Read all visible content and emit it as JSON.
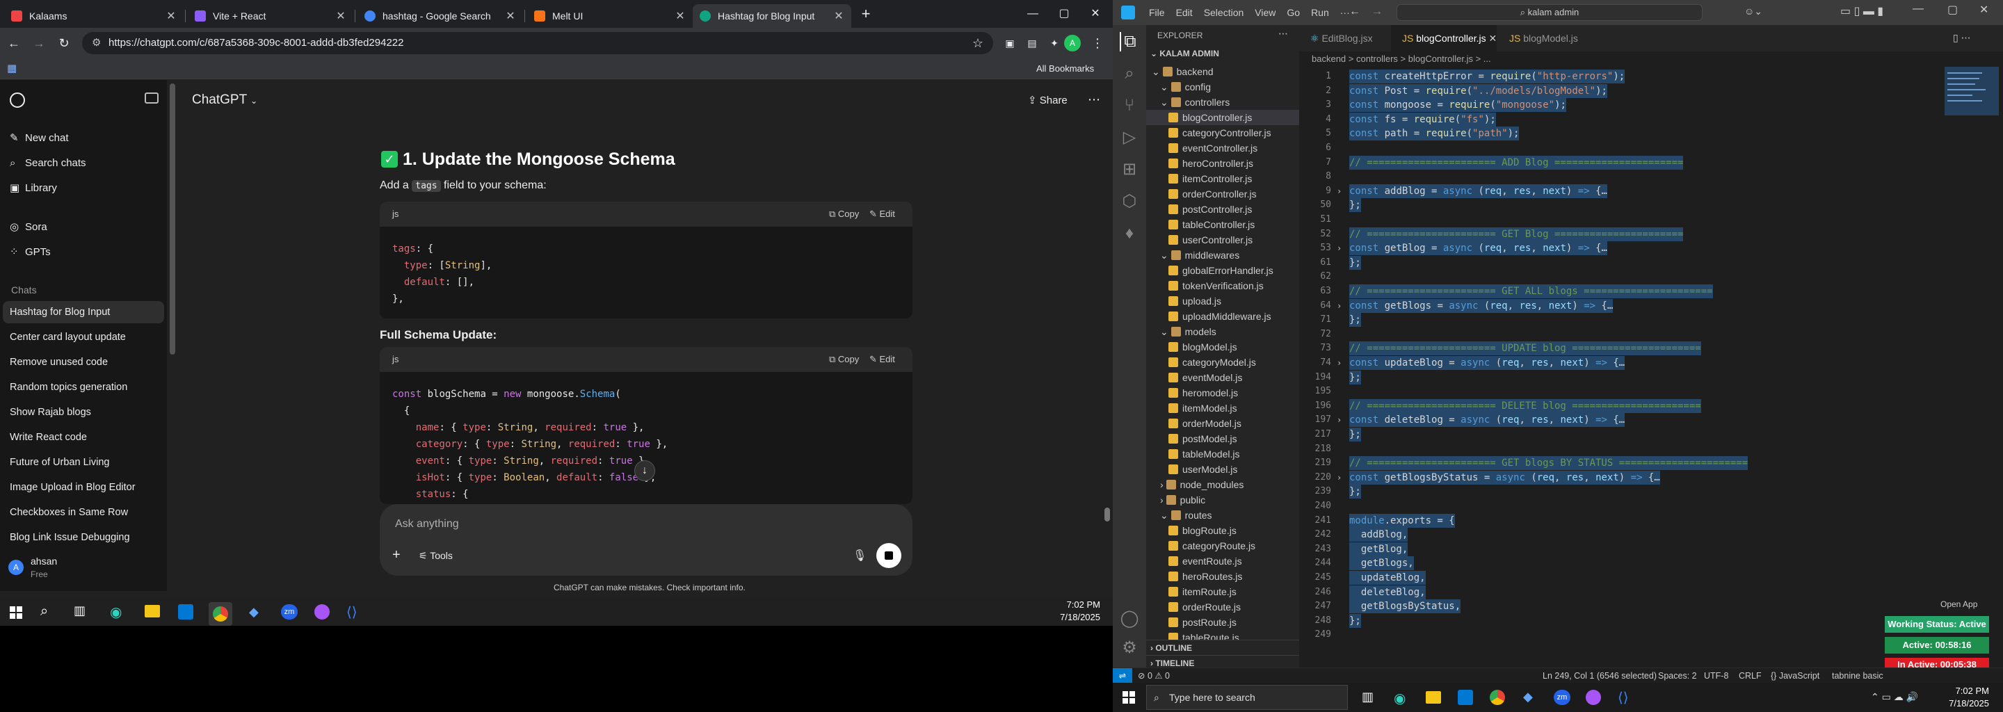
{
  "browser": {
    "tabs": [
      {
        "title": "Kalaams",
        "color": "#ef4444"
      },
      {
        "title": "Vite + React",
        "color": "#8b5cf6"
      },
      {
        "title": "hashtag - Google Search",
        "color": "#4285f4"
      },
      {
        "title": "Melt UI",
        "color": "#f97316"
      },
      {
        "title": "Hashtag for Blog Input",
        "color": "#10a37f"
      }
    ],
    "new_tab": "+",
    "url": "https://chatgpt.com/c/687a5368-309c-8001-addd-db3fed294222",
    "all_bookmarks": "All Bookmarks",
    "win_min": "—",
    "win_max": "▢",
    "win_close": "✕"
  },
  "sidebar": {
    "new_chat": "New chat",
    "search_chats": "Search chats",
    "library": "Library",
    "sora": "Sora",
    "gpts": "GPTs",
    "chats_heading": "Chats",
    "chats": [
      "Hashtag for Blog Input",
      "Center card layout update",
      "Remove unused code",
      "Random topics generation",
      "Show Rajab blogs",
      "Write React code",
      "Future of Urban Living",
      "Image Upload in Blog Editor",
      "Checkboxes in Same Row",
      "Blog Link Issue Debugging"
    ],
    "user_initial": "A",
    "user_name": "ahsan",
    "user_plan": "Free"
  },
  "chat": {
    "model": "ChatGPT",
    "share": "Share",
    "heading": "1. Update the Mongoose Schema",
    "intro_pre": "Add a",
    "intro_code": "tags",
    "intro_post": "field to your schema:",
    "code1_lang": "js",
    "copy": "Copy",
    "edit": "Edit",
    "full_heading": "Full Schema Update:",
    "code2_lang": "js",
    "composer_placeholder": "Ask anything",
    "tools": "Tools",
    "disclaimer": "ChatGPT can make mistakes. Check important info."
  },
  "taskbar_left": {
    "time": "7:02 PM",
    "date": "7/18/2025"
  },
  "vscode": {
    "menu": [
      "File",
      "Edit",
      "Selection",
      "View",
      "Go",
      "Run",
      "···"
    ],
    "search": "kalam admin",
    "explorer_title": "EXPLORER",
    "root": "KALAM ADMIN",
    "tree": [
      {
        "label": "backend",
        "indent": 0,
        "type": "folder"
      },
      {
        "label": "config",
        "indent": 1,
        "type": "folder"
      },
      {
        "label": "controllers",
        "indent": 1,
        "type": "folder"
      },
      {
        "label": "blogController.js",
        "indent": 2,
        "type": "js",
        "selected": true
      },
      {
        "label": "categoryController.js",
        "indent": 2,
        "type": "js"
      },
      {
        "label": "eventController.js",
        "indent": 2,
        "type": "js"
      },
      {
        "label": "heroController.js",
        "indent": 2,
        "type": "js"
      },
      {
        "label": "itemController.js",
        "indent": 2,
        "type": "js"
      },
      {
        "label": "orderController.js",
        "indent": 2,
        "type": "js"
      },
      {
        "label": "postController.js",
        "indent": 2,
        "type": "js"
      },
      {
        "label": "tableController.js",
        "indent": 2,
        "type": "js"
      },
      {
        "label": "userController.js",
        "indent": 2,
        "type": "js"
      },
      {
        "label": "middlewares",
        "indent": 1,
        "type": "folder"
      },
      {
        "label": "globalErrorHandler.js",
        "indent": 2,
        "type": "js"
      },
      {
        "label": "tokenVerification.js",
        "indent": 2,
        "type": "js"
      },
      {
        "label": "upload.js",
        "indent": 2,
        "type": "js"
      },
      {
        "label": "uploadMiddleware.js",
        "indent": 2,
        "type": "js"
      },
      {
        "label": "models",
        "indent": 1,
        "type": "folder"
      },
      {
        "label": "blogModel.js",
        "indent": 2,
        "type": "js"
      },
      {
        "label": "categoryModel.js",
        "indent": 2,
        "type": "js"
      },
      {
        "label": "eventModel.js",
        "indent": 2,
        "type": "js"
      },
      {
        "label": "heromodel.js",
        "indent": 2,
        "type": "js"
      },
      {
        "label": "itemModel.js",
        "indent": 2,
        "type": "js"
      },
      {
        "label": "orderModel.js",
        "indent": 2,
        "type": "js"
      },
      {
        "label": "postModel.js",
        "indent": 2,
        "type": "js"
      },
      {
        "label": "tableModel.js",
        "indent": 2,
        "type": "js"
      },
      {
        "label": "userModel.js",
        "indent": 2,
        "type": "js"
      },
      {
        "label": "node_modules",
        "indent": 1,
        "type": "folder"
      },
      {
        "label": "public",
        "indent": 1,
        "type": "folder"
      },
      {
        "label": "routes",
        "indent": 1,
        "type": "folder"
      },
      {
        "label": "blogRoute.js",
        "indent": 2,
        "type": "js"
      },
      {
        "label": "categoryRoute.js",
        "indent": 2,
        "type": "js"
      },
      {
        "label": "eventRoute.js",
        "indent": 2,
        "type": "js"
      },
      {
        "label": "heroRoutes.js",
        "indent": 2,
        "type": "js"
      },
      {
        "label": "itemRoute.js",
        "indent": 2,
        "type": "js"
      },
      {
        "label": "orderRoute.js",
        "indent": 2,
        "type": "js"
      },
      {
        "label": "postRoute.js",
        "indent": 2,
        "type": "js"
      },
      {
        "label": "tableRoute.js",
        "indent": 2,
        "type": "js"
      }
    ],
    "outline": "OUTLINE",
    "timeline": "TIMELINE",
    "tabs": [
      "EditBlog.jsx",
      "blogController.js",
      "blogModel.js"
    ],
    "breadcrumb": "backend > controllers > blogController.js > ...",
    "lines": [
      {
        "n": "1",
        "code": "const createHttpError = require(\"http-errors\");"
      },
      {
        "n": "2",
        "code": "const Post = require(\"../models/blogModel\");"
      },
      {
        "n": "3",
        "code": "const mongoose = require(\"mongoose\");"
      },
      {
        "n": "4",
        "code": "const fs = require(\"fs\");"
      },
      {
        "n": "5",
        "code": "const path = require(\"path\");"
      },
      {
        "n": "6",
        "code": ""
      },
      {
        "n": "7",
        "code": "// ====================== ADD Blog ======================"
      },
      {
        "n": "8",
        "code": ""
      },
      {
        "n": "9",
        "code": "const addBlog = async (req, res, next) => {…"
      },
      {
        "n": "50",
        "code": "};"
      },
      {
        "n": "51",
        "code": ""
      },
      {
        "n": "52",
        "code": "// ====================== GET Blog ======================"
      },
      {
        "n": "53",
        "code": "const getBlog = async (req, res, next) => {…"
      },
      {
        "n": "61",
        "code": "};"
      },
      {
        "n": "62",
        "code": ""
      },
      {
        "n": "63",
        "code": "// ====================== GET ALL blogs ======================"
      },
      {
        "n": "64",
        "code": "const getBlogs = async (req, res, next) => {…"
      },
      {
        "n": "71",
        "code": "};"
      },
      {
        "n": "72",
        "code": ""
      },
      {
        "n": "73",
        "code": "// ====================== UPDATE blog ======================"
      },
      {
        "n": "74",
        "code": "const updateBlog = async (req, res, next) => {…"
      },
      {
        "n": "194",
        "code": "};"
      },
      {
        "n": "195",
        "code": ""
      },
      {
        "n": "196",
        "code": "// ====================== DELETE blog ======================"
      },
      {
        "n": "197",
        "code": "const deleteBlog = async (req, res, next) => {…"
      },
      {
        "n": "217",
        "code": "};"
      },
      {
        "n": "218",
        "code": ""
      },
      {
        "n": "219",
        "code": "// ====================== GET blogs BY STATUS ======================"
      },
      {
        "n": "220",
        "code": "const getBlogsByStatus = async (req, res, next) => {…"
      },
      {
        "n": "239",
        "code": "};"
      },
      {
        "n": "240",
        "code": ""
      },
      {
        "n": "241",
        "code": "module.exports = {"
      },
      {
        "n": "242",
        "code": "  addBlog,"
      },
      {
        "n": "243",
        "code": "  getBlog,"
      },
      {
        "n": "244",
        "code": "  getBlogs,"
      },
      {
        "n": "245",
        "code": "  updateBlog,"
      },
      {
        "n": "246",
        "code": "  deleteBlog,"
      },
      {
        "n": "247",
        "code": "  getBlogsByStatus,"
      },
      {
        "n": "248",
        "code": "};"
      },
      {
        "n": "249",
        "code": ""
      }
    ],
    "open_app": "Open App",
    "working_status": "Working Status: Active",
    "active_time": "Active: 00:58:16",
    "inactive_time": "In Active: 00:05:38",
    "status": {
      "errors": "⊘ 0 ⚠ 0",
      "cursor": "Ln 249, Col 1 (6546 selected)",
      "spaces": "Spaces: 2",
      "encoding": "UTF-8",
      "eol": "CRLF",
      "lang": "{} JavaScript",
      "tabnine": "tabnine basic"
    }
  },
  "taskbar_right": {
    "search_placeholder": "Type here to search",
    "time": "7:02 PM",
    "date": "7/18/2025"
  }
}
